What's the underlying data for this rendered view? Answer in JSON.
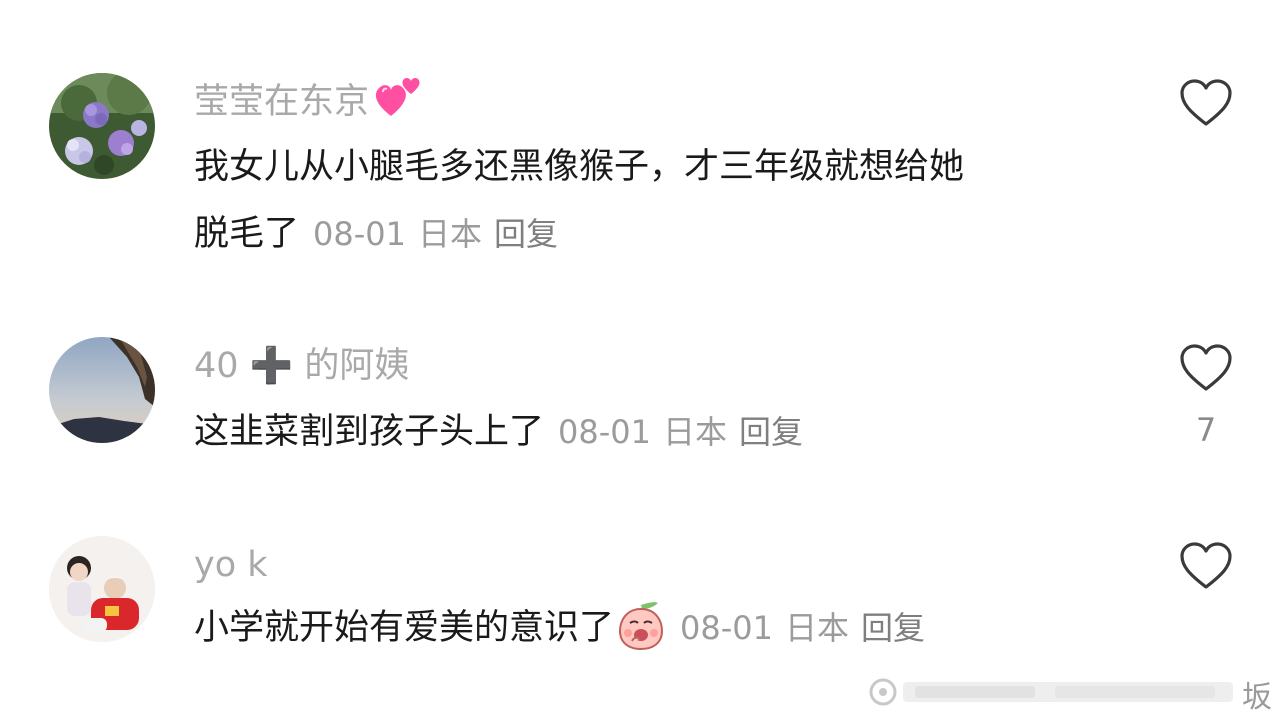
{
  "comments": [
    {
      "username": "莹莹在东京",
      "username_emoji": "two-hearts-emoji",
      "text_line1": "我女儿从小腿毛多还黑像猴子，才三年级就想给她",
      "text_line2": "脱毛了",
      "date": "08-01",
      "location": "日本",
      "reply_label": "回复",
      "like_count": ""
    },
    {
      "username": "40 ➕ 的阿姨",
      "text_line1": "这韭菜割到孩子头上了",
      "date": "08-01",
      "location": "日本",
      "reply_label": "回复",
      "like_count": "7"
    },
    {
      "username": "yo k",
      "text_line1": "小学就开始有爱美的意识了",
      "text_emoji": "peach-shy-emoji",
      "date": "08-01",
      "location": "日本",
      "reply_label": "回复",
      "like_count": ""
    }
  ],
  "watermark": {
    "label": "坂"
  },
  "colors": {
    "username": "#a9a9a9",
    "body_text": "#1a1a1a",
    "meta": "#9b9b9b",
    "reply": "#7f7f7f",
    "heart_outline": "#3a3a3a",
    "pink_heart": "#ff4fa3"
  }
}
